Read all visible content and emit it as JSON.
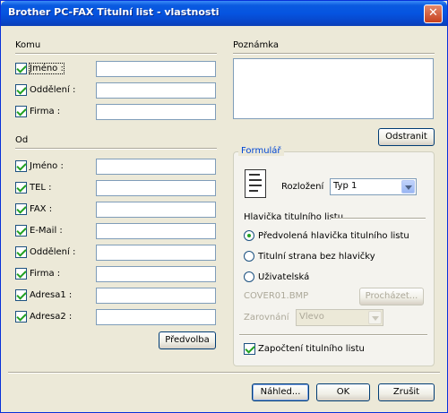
{
  "window": {
    "title": "Brother PC-FAX Titulní list - vlastnosti",
    "close_glyph": "✕"
  },
  "to_section": {
    "label": "Komu",
    "fields": [
      {
        "label": "Jméno :",
        "checked": true,
        "value": ""
      },
      {
        "label": "Oddělení :",
        "checked": true,
        "value": ""
      },
      {
        "label": "Firma :",
        "checked": true,
        "value": ""
      }
    ]
  },
  "from_section": {
    "label": "Od",
    "fields": [
      {
        "label": "Jméno :",
        "checked": true,
        "value": ""
      },
      {
        "label": "TEL :",
        "checked": true,
        "value": ""
      },
      {
        "label": "FAX :",
        "checked": true,
        "value": ""
      },
      {
        "label": "E-Mail :",
        "checked": true,
        "value": ""
      },
      {
        "label": "Oddělení :",
        "checked": true,
        "value": ""
      },
      {
        "label": "Firma :",
        "checked": true,
        "value": ""
      },
      {
        "label": "Adresa1 :",
        "checked": true,
        "value": ""
      },
      {
        "label": "Adresa2 :",
        "checked": true,
        "value": ""
      }
    ],
    "preset_button": "Předvolba"
  },
  "note": {
    "label": "Poznámka",
    "value": "",
    "clear_button": "Odstranit"
  },
  "format": {
    "label": "Formulář",
    "layout_label": "Rozložení",
    "layout_value": "Typ 1",
    "header_label": "Hlavička titulního listu",
    "options": [
      {
        "label": "Předvolená hlavička titulního listu",
        "selected": true
      },
      {
        "label": "Titulní strana bez hlavičky",
        "selected": false
      },
      {
        "label": "Uživatelská",
        "selected": false
      }
    ],
    "file_value": "COVER01.BMP",
    "browse_button": "Procházet...",
    "align_label": "Zarovnání",
    "align_value": "Vlevo",
    "count_label": "Započtení titulního listu",
    "count_checked": true
  },
  "footer": {
    "preview_button": "Náhled...",
    "ok_button": "OK",
    "cancel_button": "Zrušit"
  },
  "colors": {
    "title_blue": "#0554e0",
    "dialog_bg": "#ece9d8",
    "group_title": "#0046d5",
    "check_green": "#21a121"
  }
}
